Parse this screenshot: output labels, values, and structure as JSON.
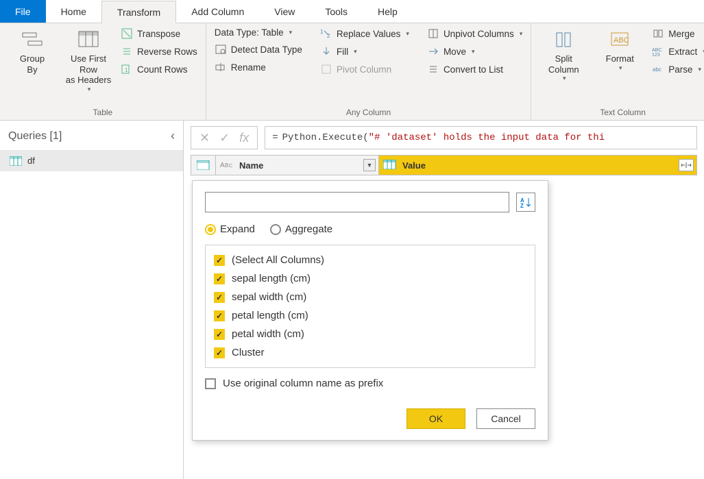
{
  "tabs": {
    "file": "File",
    "home": "Home",
    "transform": "Transform",
    "addcolumn": "Add Column",
    "view": "View",
    "tools": "Tools",
    "help": "Help"
  },
  "ribbon": {
    "table": {
      "group_by": "Group\nBy",
      "first_row": "Use First Row\nas Headers",
      "transpose": "Transpose",
      "reverse_rows": "Reverse Rows",
      "count_rows": "Count Rows",
      "label": "Table"
    },
    "anycol": {
      "datatype": "Data Type: Table",
      "detect": "Detect Data Type",
      "rename": "Rename",
      "replace": "Replace Values",
      "fill": "Fill",
      "pivot": "Pivot Column",
      "unpivot": "Unpivot Columns",
      "move": "Move",
      "convert": "Convert to List",
      "label": "Any Column"
    },
    "textcol": {
      "split": "Split\nColumn",
      "format": "Format",
      "merge": "Merge",
      "extract": "Extract",
      "parse": "Parse",
      "label": "Text Column"
    }
  },
  "queries": {
    "title": "Queries [1]",
    "items": [
      "df"
    ]
  },
  "formula": {
    "prefix": "= ",
    "fn": "Python.Execute",
    "open": "(",
    "arg": "\"# 'dataset' holds the input data for thi"
  },
  "columns": {
    "name": "Name",
    "value": "Value"
  },
  "popup": {
    "expand": "Expand",
    "aggregate": "Aggregate",
    "sort_hint": "A↓",
    "cols": [
      "(Select All Columns)",
      "sepal length (cm)",
      "sepal width (cm)",
      "petal length (cm)",
      "petal width (cm)",
      "Cluster"
    ],
    "prefix": "Use original column name as prefix",
    "ok": "OK",
    "cancel": "Cancel"
  }
}
